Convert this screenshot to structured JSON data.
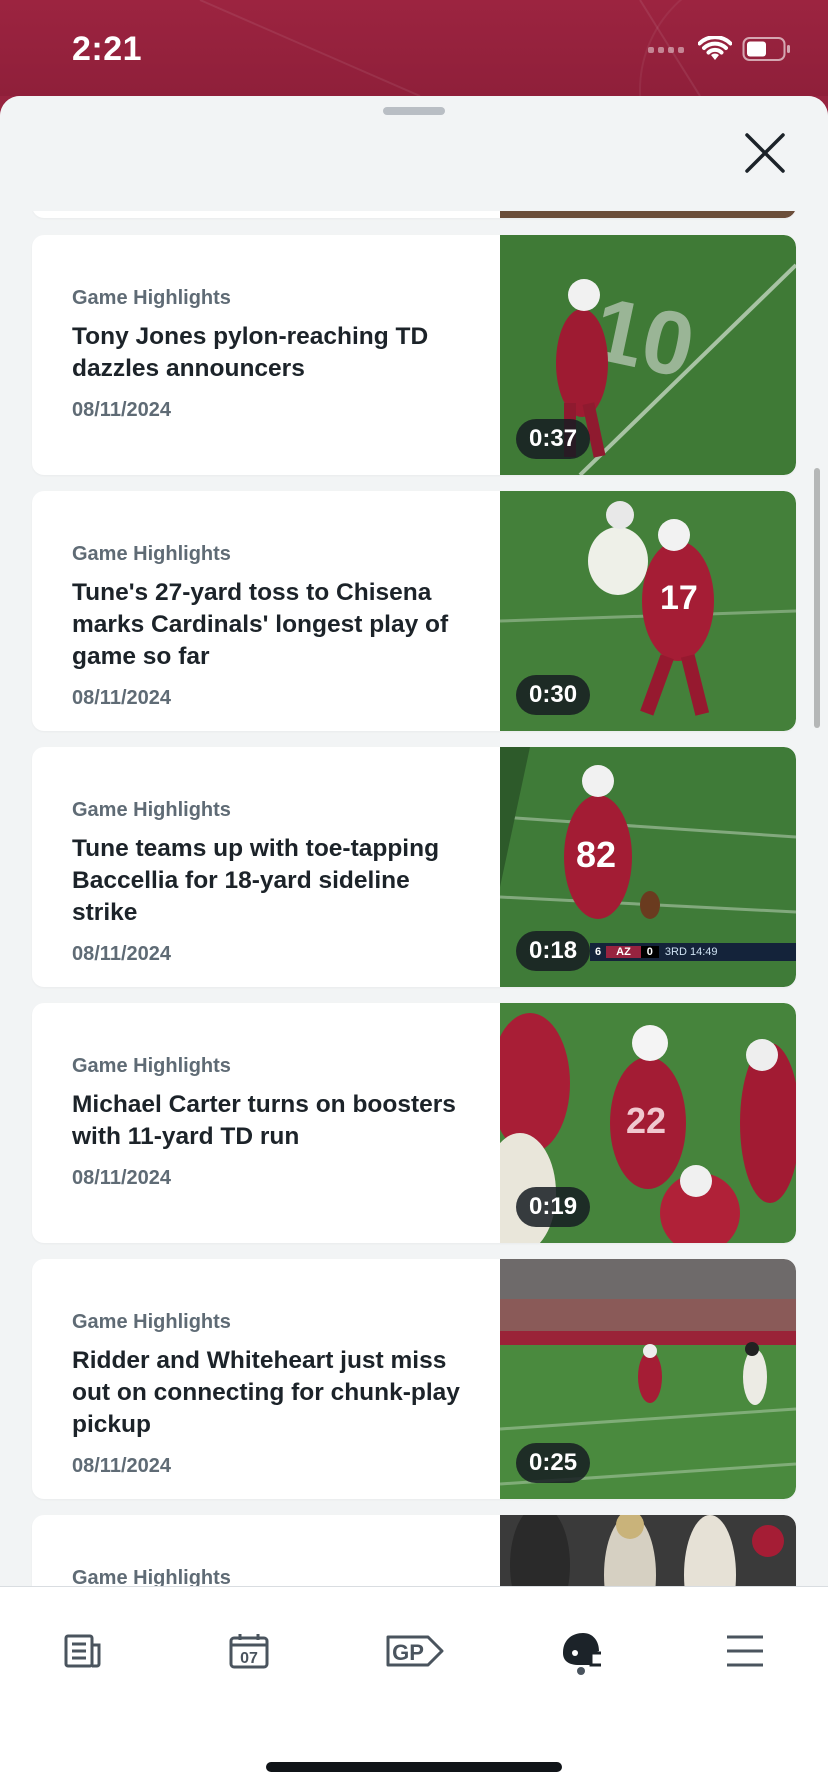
{
  "status_bar": {
    "time": "2:21"
  },
  "sheet": {
    "close_label": "close"
  },
  "videos": [
    {
      "category": "Game Highlights",
      "title": "Tony Jones pylon-reaching TD dazzles announcers",
      "date": "08/11/2024",
      "duration": "0:37",
      "thumbnail": "player-running-endzone"
    },
    {
      "category": "Game Highlights",
      "title": "Tune's 27-yard toss to Chisena marks Cardinals' longest play of game so far",
      "date": "08/11/2024",
      "duration": "0:30",
      "thumbnail": "receiver-17-catch"
    },
    {
      "category": "Game Highlights",
      "title": "Tune teams up with toe-tapping Baccellia for 18-yard sideline strike",
      "date": "08/11/2024",
      "duration": "0:18",
      "thumbnail": "receiver-82-sideline",
      "scorebug": {
        "away_score": "6",
        "home_team": "AZ",
        "home_score": "0",
        "clock": "3RD 14:49"
      }
    },
    {
      "category": "Game Highlights",
      "title": "Michael Carter turns on boosters with 11-yard TD run",
      "date": "08/11/2024",
      "duration": "0:19",
      "thumbnail": "team-celebration"
    },
    {
      "category": "Game Highlights",
      "title": "Ridder and Whiteheart just miss out on connecting for chunk-play pickup",
      "date": "08/11/2024",
      "duration": "0:25",
      "thumbnail": "wide-field-play"
    },
    {
      "category": "Game Highlights",
      "title": "",
      "date": "",
      "duration": "",
      "thumbnail": "sideline-crowd"
    }
  ],
  "tab_bar": {
    "items": [
      {
        "id": "news",
        "icon": "news-icon"
      },
      {
        "id": "schedule",
        "icon": "calendar-icon",
        "text": "07"
      },
      {
        "id": "gameplan",
        "icon": "gp-icon",
        "text": "GP"
      },
      {
        "id": "videos",
        "icon": "helmet-icon",
        "active": true
      },
      {
        "id": "menu",
        "icon": "menu-icon"
      }
    ]
  },
  "colors": {
    "brand": "#97233F",
    "text_primary": "#1c2329",
    "text_secondary": "#5f6b75",
    "field_green": "#3f7a36"
  }
}
